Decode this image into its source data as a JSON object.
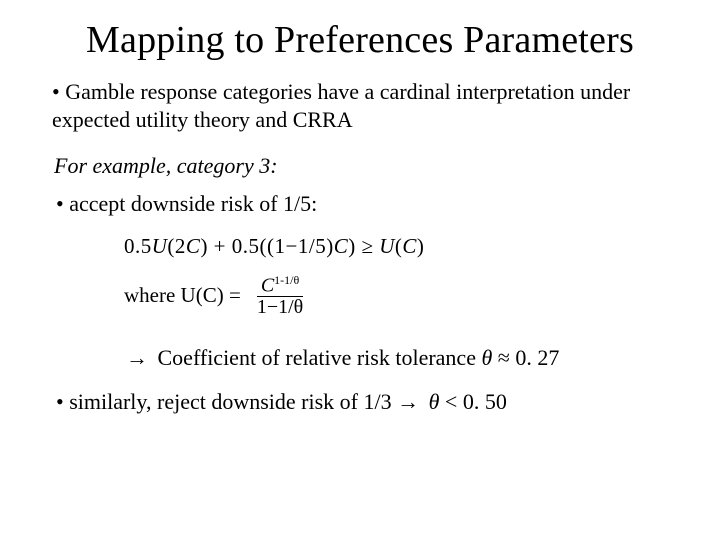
{
  "title": "Mapping to Preferences Parameters",
  "bullet_intro": "• Gamble response categories have a cardinal interpretation under expected utility theory and CRRA",
  "example_label": "For example, category 3:",
  "bullet_accept": "• accept downside risk of 1/5:",
  "math": {
    "inequality": "0.5U(2C) + 0.5((1−1/5)C) ≥ U(C)",
    "where_prefix": "where U(C) =",
    "frac_num_base": "C",
    "frac_num_exp": "1-1/θ",
    "frac_den": "1−1/θ"
  },
  "coef_line_prefix": "Coefficient of relative risk tolerance ",
  "theta": "θ",
  "approx": " ≈ ",
  "coef_value": "0. 27",
  "similar_prefix": "• similarly, reject downside risk of 1/3 ",
  "lt": " < ",
  "similar_value": "0. 50",
  "arrow": "→"
}
